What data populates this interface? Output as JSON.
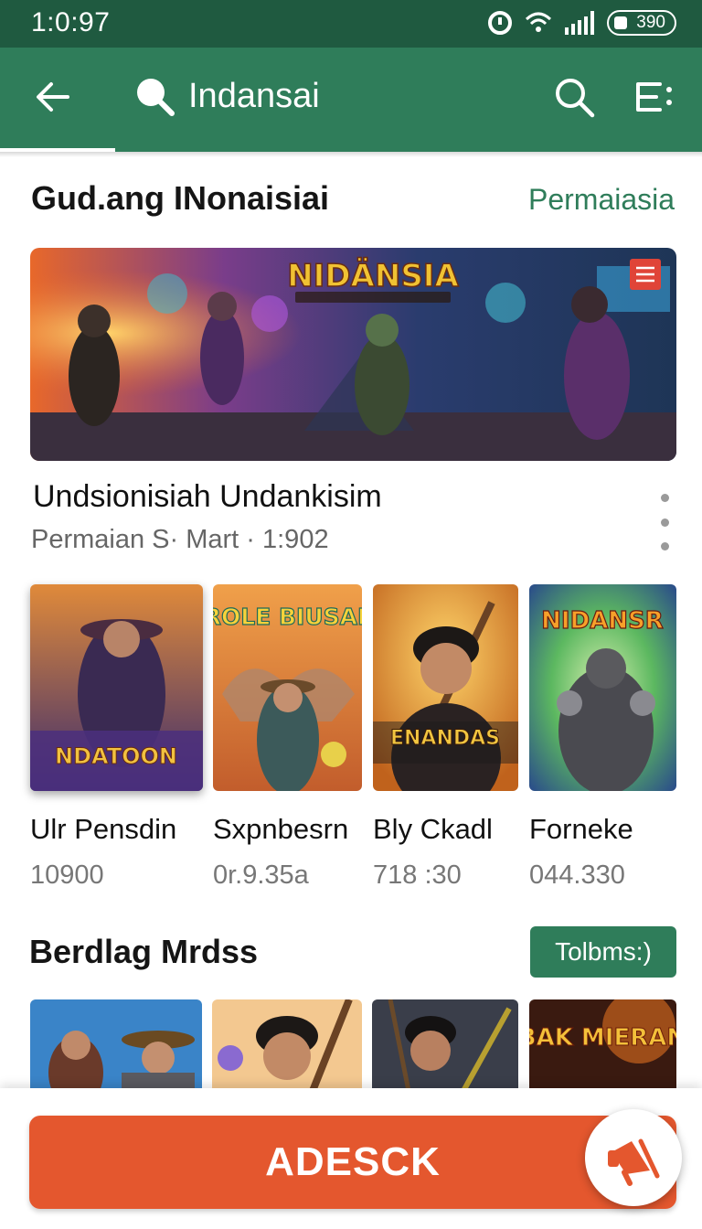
{
  "status_bar": {
    "time": "1:0:97",
    "battery": "390"
  },
  "app_bar": {
    "title": "Indansai"
  },
  "section1": {
    "title": "Gud.ang INonaisiai",
    "link": "Permaiasia"
  },
  "banner": {
    "logo_text": "NIDÄNSIA"
  },
  "feature": {
    "title": "Undsionisiah Undankisim",
    "meta": "Permaian S· Mart · 1:902"
  },
  "cards": [
    {
      "name": "Ulr Pensdin",
      "count": "10900",
      "art_text": "NDATOON"
    },
    {
      "name": "Sxpnbesrn",
      "count": "0r.9.35a",
      "art_text": "HEROLE BIUSALER"
    },
    {
      "name": "Bly Ckadl",
      "count": "718 :30",
      "art_text": "ENANDAS"
    },
    {
      "name": "Forneke",
      "count": "044.330",
      "art_text": "NIDANSR"
    }
  ],
  "section2": {
    "title": "Berdlag Mrdss",
    "tag_button": "Tolbms:)"
  },
  "thumbs": [
    {
      "art_text": ""
    },
    {
      "art_text": ""
    },
    {
      "art_text": ""
    },
    {
      "art_text": "RBAK MIERANA"
    }
  ],
  "cta": {
    "label": "ADESCK"
  },
  "colors": {
    "status_bar": "#1f5a40",
    "app_bar": "#2f7d5a",
    "accent": "#2f7d5a",
    "cta": "#e4572e"
  },
  "icons": {
    "back": "arrow-left-icon",
    "search": "search-icon",
    "menu": "list-menu-icon",
    "fab": "megaphone-icon"
  }
}
